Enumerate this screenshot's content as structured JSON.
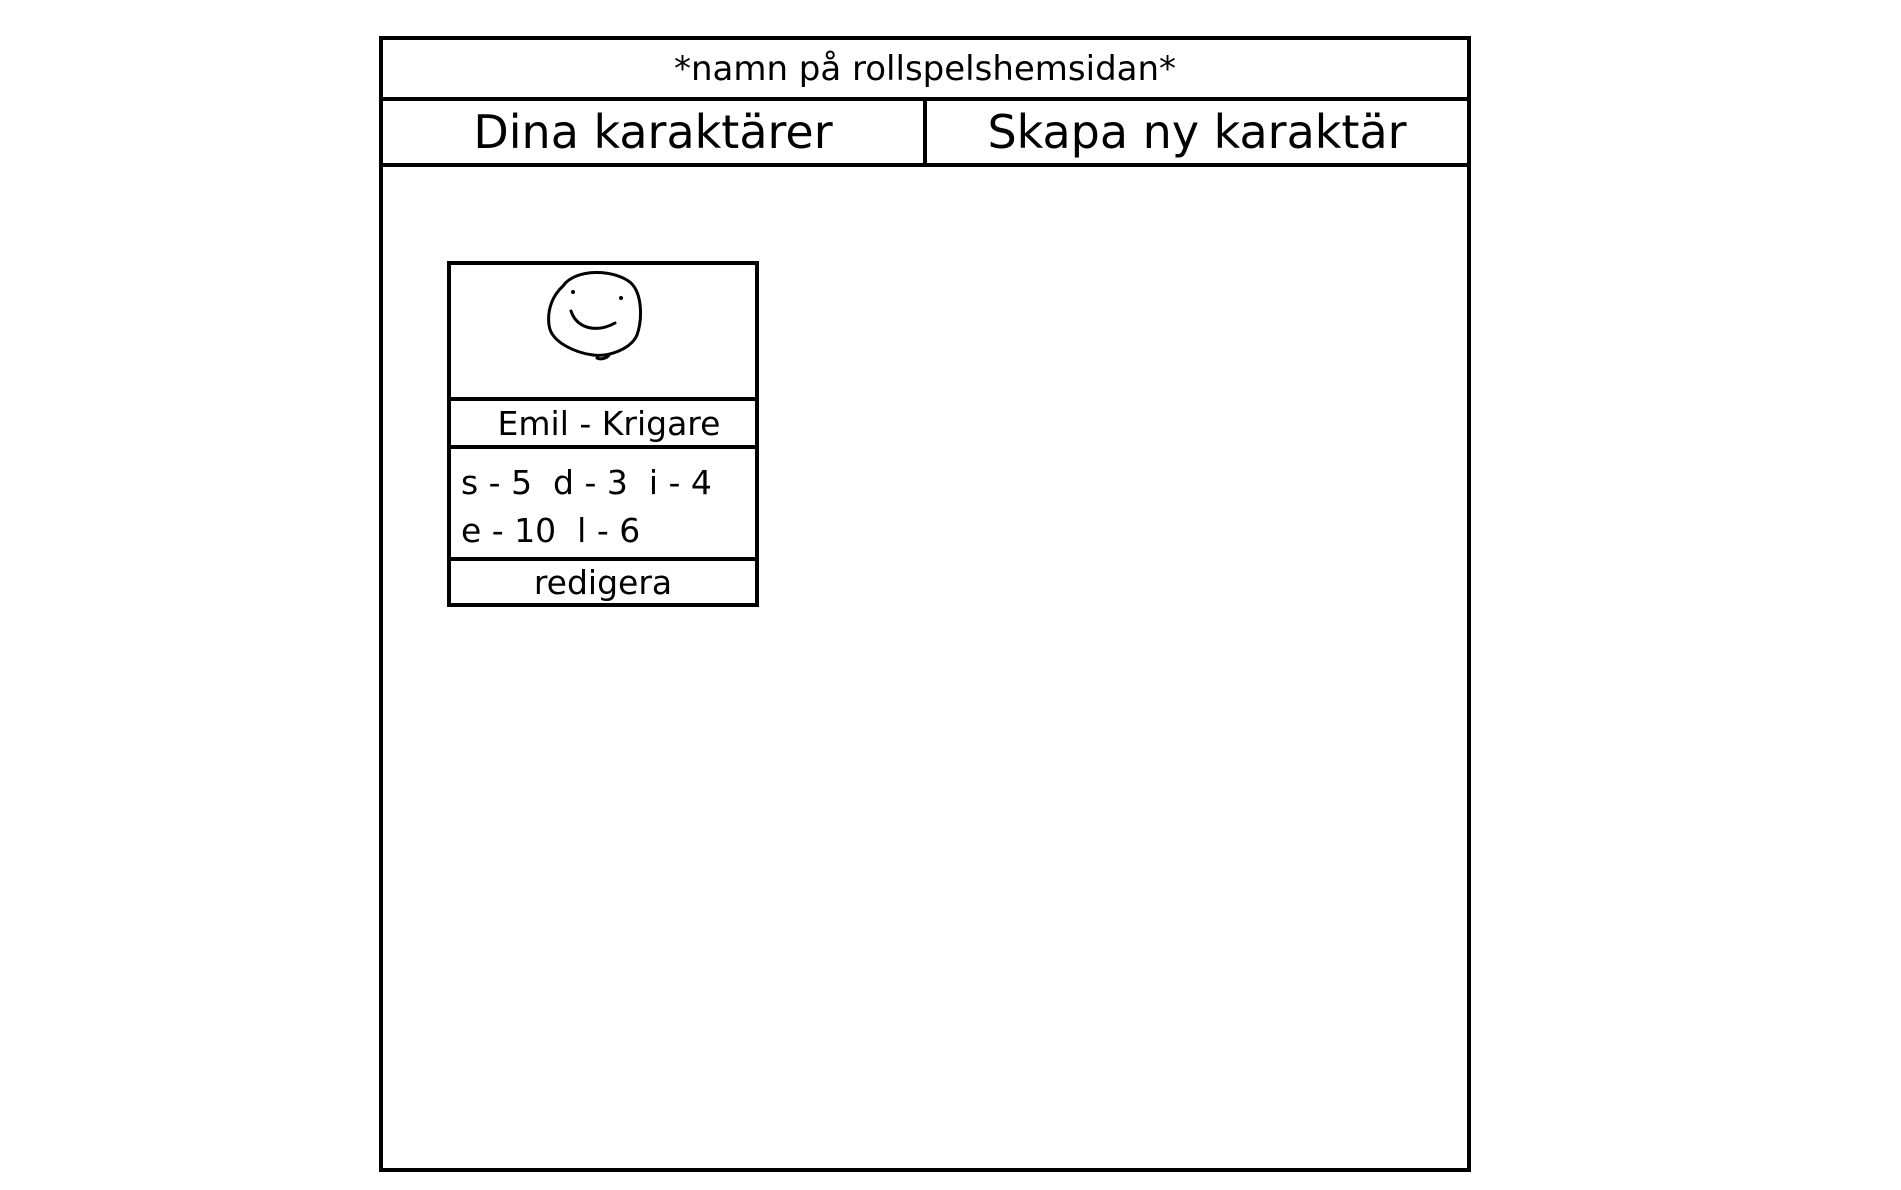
{
  "site": {
    "title": "*namn på rollspelshemsidan*"
  },
  "nav": {
    "items": [
      {
        "label": "Dina karaktärer"
      },
      {
        "label": "Skapa ny karaktär"
      }
    ]
  },
  "characters": [
    {
      "portrait_icon": "smiley-face-icon",
      "name_line": "Emil - Krigare",
      "stats_lines": [
        "s - 5  d - 3  i - 4",
        "e - 10  l - 6"
      ],
      "edit_label": "redigera"
    }
  ]
}
